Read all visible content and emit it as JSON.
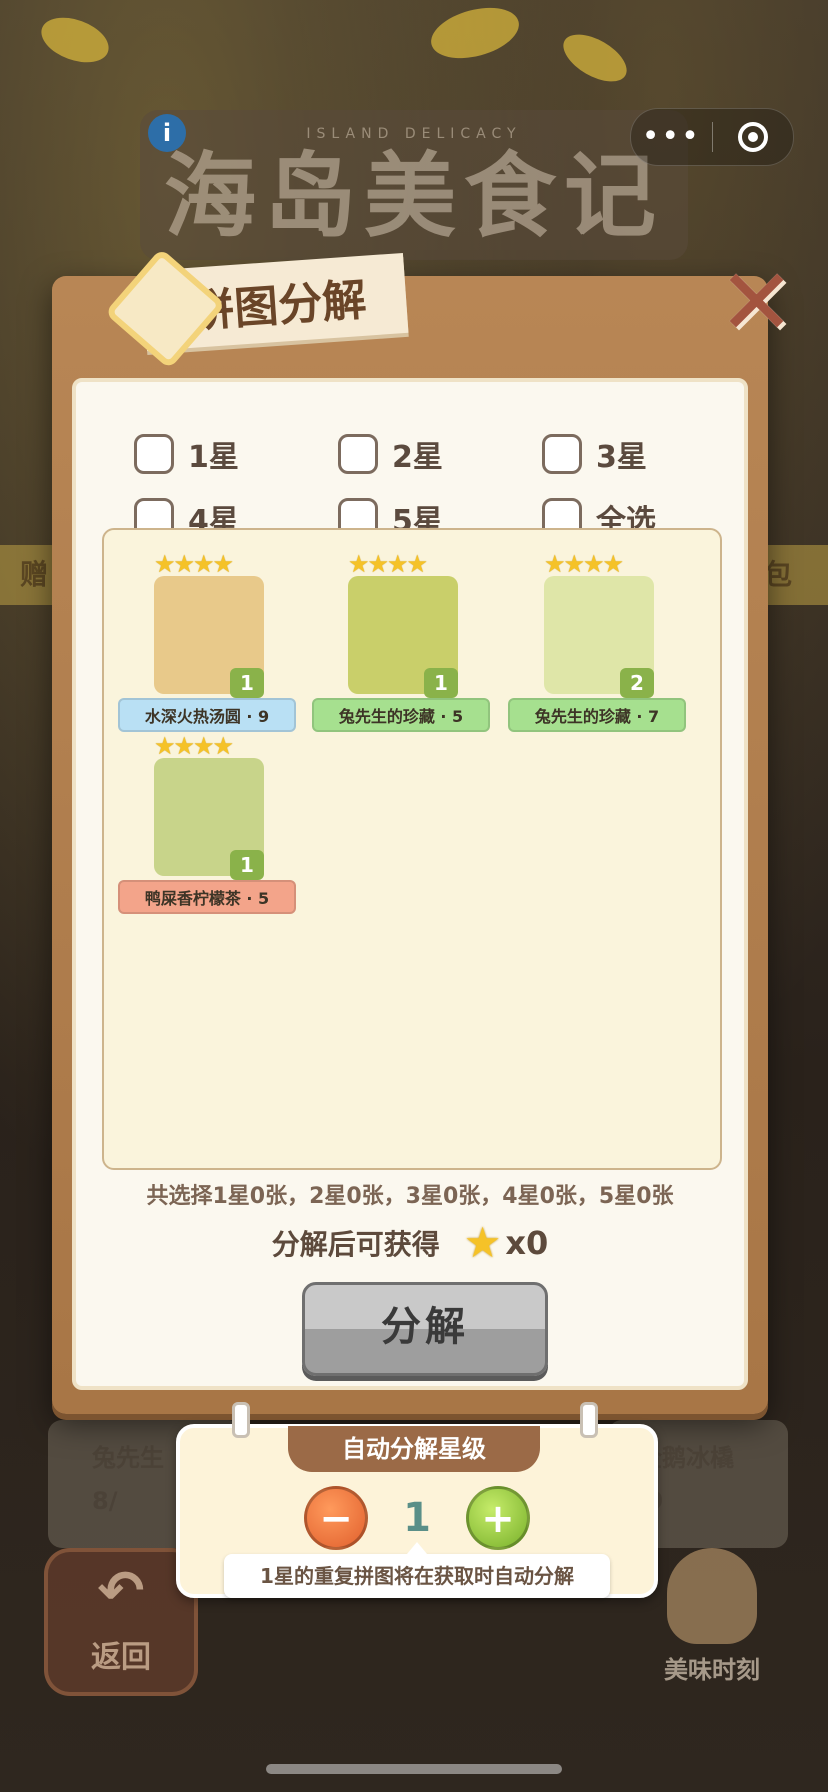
{
  "topbar": {
    "more_icon": "more-dots-icon",
    "close_icon": "target-circle-icon",
    "more_glyph": "•••"
  },
  "game": {
    "info_icon": "info-icon",
    "info_glyph": "i",
    "logo_subtitle": "ISLAND DELICACY",
    "logo_title": "海岛美食记"
  },
  "background": {
    "strip_left": "赠",
    "strip_right": "包",
    "card_left_label": "兔先生",
    "card_left_progress": "8/",
    "card_right_label": "企鹅冰橇",
    "card_right_progress": "/9"
  },
  "dialog": {
    "title": "拼图分解",
    "close_glyph": "✕",
    "filters": [
      {
        "label": "1星",
        "checked": false
      },
      {
        "label": "2星",
        "checked": false
      },
      {
        "label": "3星",
        "checked": false
      },
      {
        "label": "4星",
        "checked": false
      },
      {
        "label": "5星",
        "checked": false
      },
      {
        "label": "全选",
        "checked": false
      }
    ],
    "pieces": [
      {
        "stars": "★★★★",
        "name": "水深火热汤圆 · 9",
        "count": "1",
        "banner_color": "blue",
        "art_color": "#e8c98a"
      },
      {
        "stars": "★★★★",
        "name": "兔先生的珍藏 · 5",
        "count": "1",
        "banner_color": "green",
        "art_color": "#c9cf6a"
      },
      {
        "stars": "★★★★",
        "name": "兔先生的珍藏 · 7",
        "count": "2",
        "banner_color": "green",
        "art_color": "#dfe6a8"
      },
      {
        "stars": "★★★★",
        "name": "鸭屎香柠檬茶 · 5",
        "count": "1",
        "banner_color": "red",
        "art_color": "#c8d48a"
      }
    ],
    "summary": "共选择1星0张，2星0张，3星0张，4星0张，5星0张",
    "reward_label": "分解后可获得",
    "reward_icon": "star-icon",
    "reward_qty": "x0",
    "decompose_label": "分解"
  },
  "auto": {
    "title": "自动分解星级",
    "minus_glyph": "−",
    "plus_glyph": "+",
    "level": "1",
    "hint": "1星的重复拼图将在获取时自动分解"
  },
  "bottom": {
    "back_label": "返回",
    "moment_label": "美味时刻"
  }
}
